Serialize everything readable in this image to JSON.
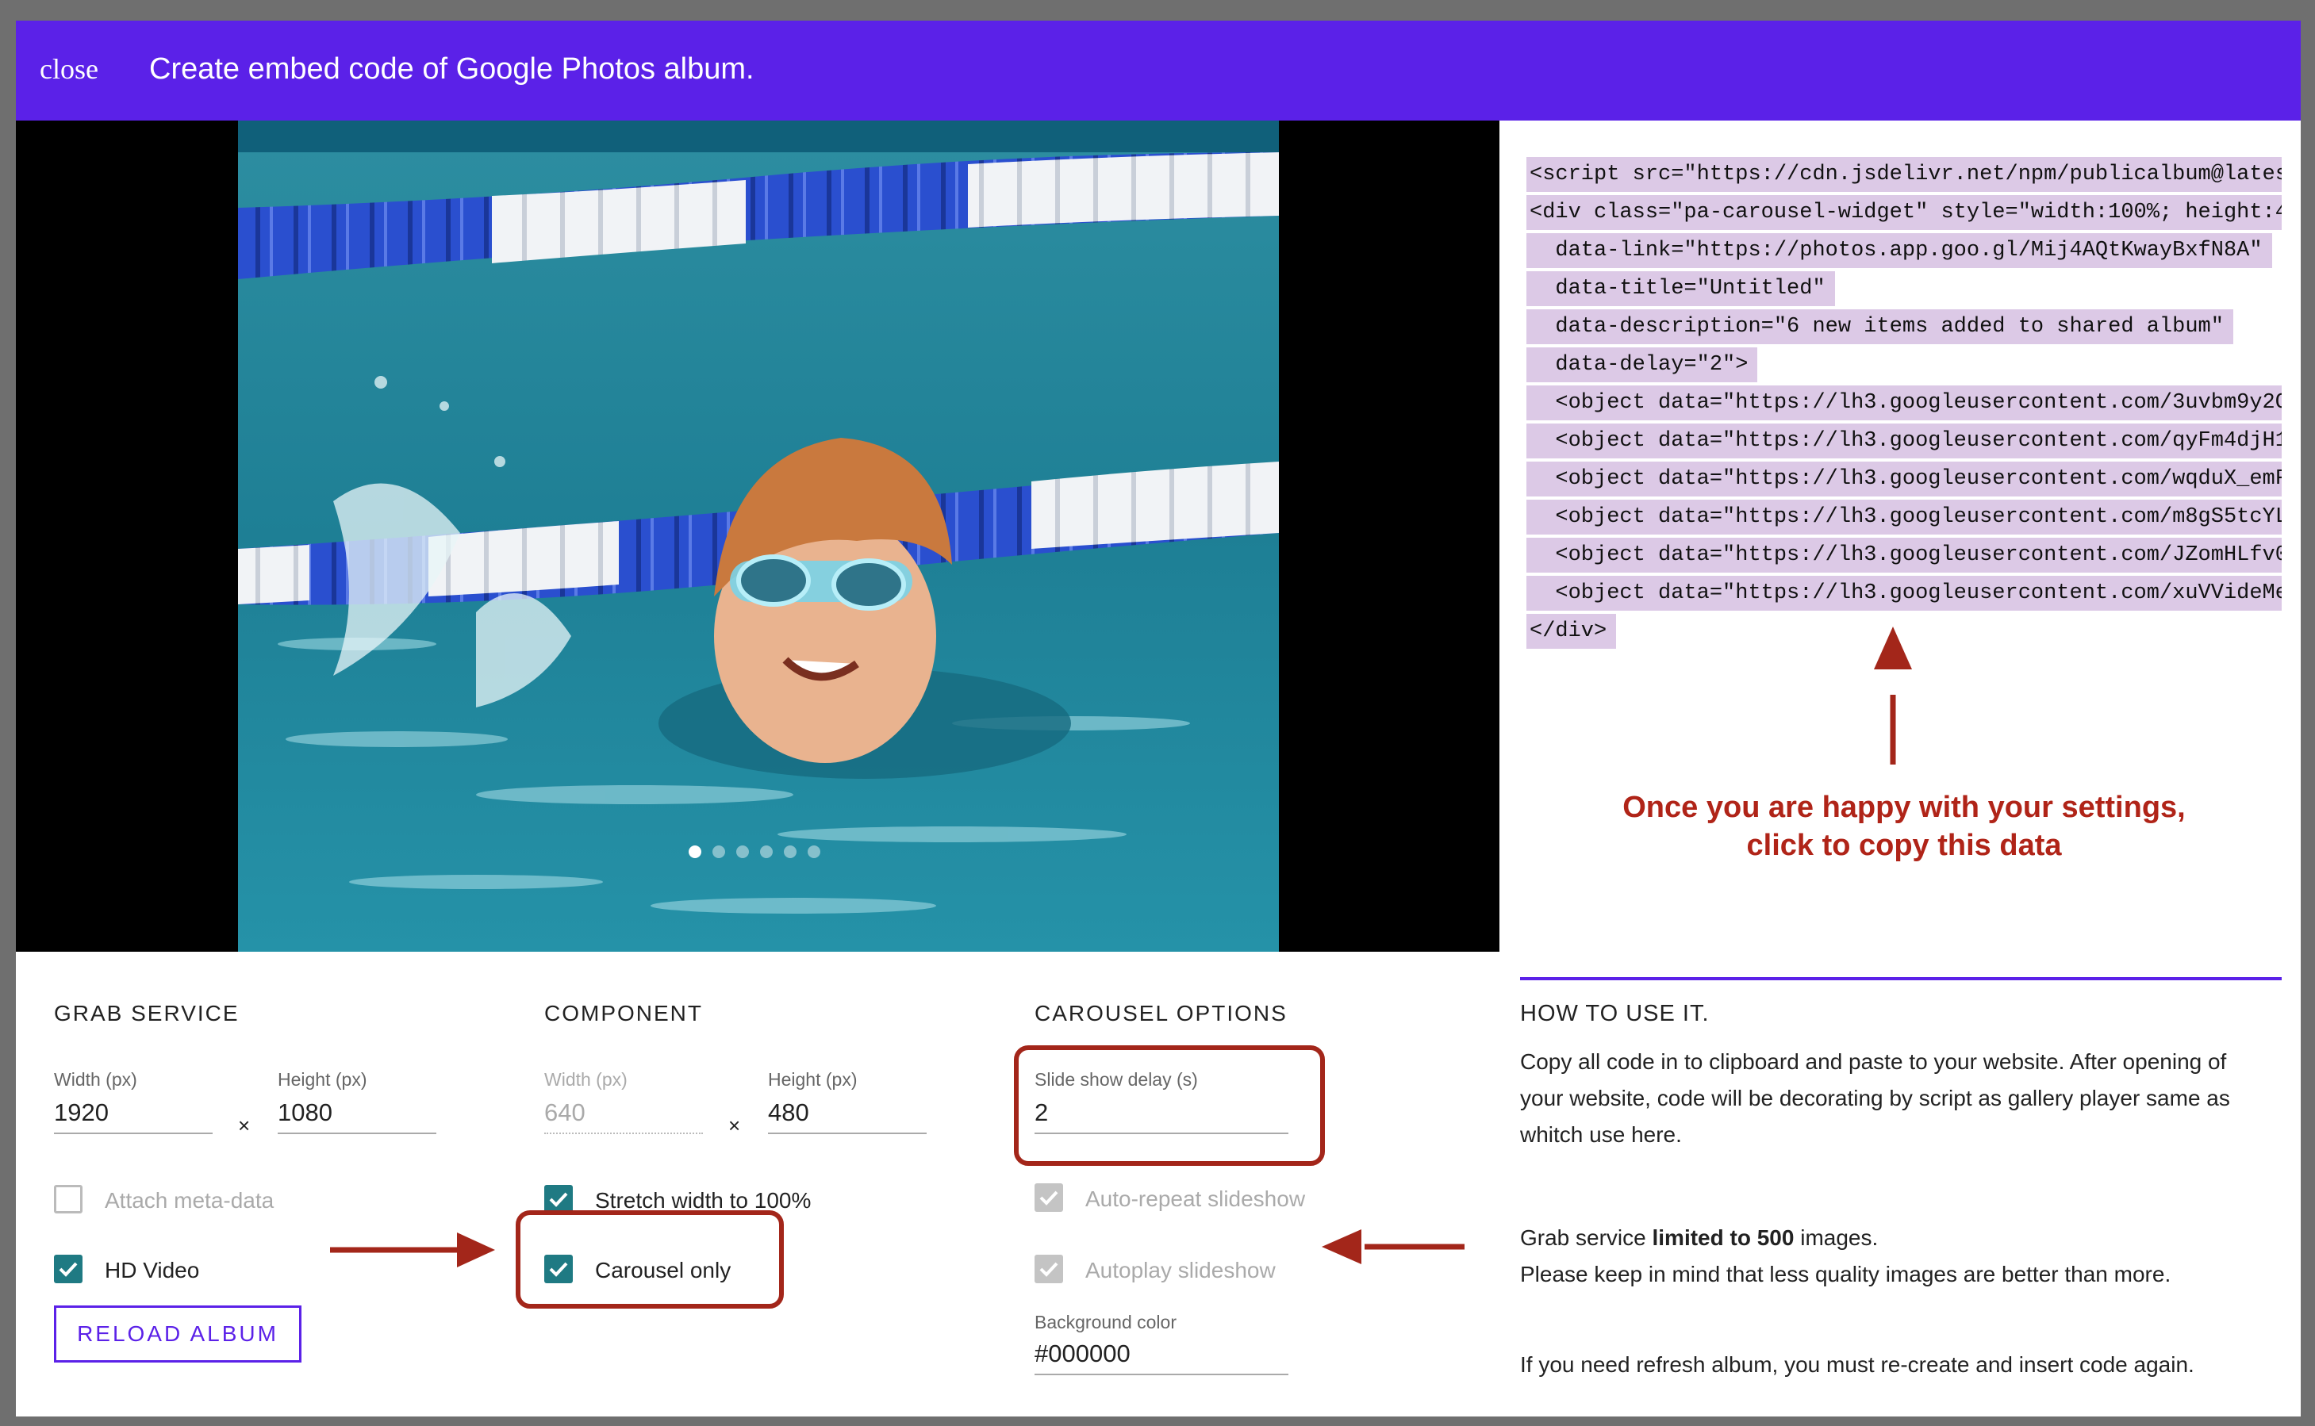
{
  "header": {
    "close_label": "close",
    "title": "Create embed code of Google Photos album."
  },
  "viewer": {
    "dots": [
      true,
      false,
      false,
      false,
      false,
      false
    ]
  },
  "code": {
    "lines": [
      "<script src=\"https://cdn.jsdelivr.net/npm/publicalbum@lates",
      "<div class=\"pa-carousel-widget\" style=\"width:100%; height:4",
      "  data-link=\"https://photos.app.goo.gl/Mij4AQtKwayBxfN8A\"",
      "  data-title=\"Untitled\"",
      "  data-description=\"6 new items added to shared album\"",
      "  data-delay=\"2\">",
      "  <object data=\"https://lh3.googleusercontent.com/3uvbm9y2O",
      "  <object data=\"https://lh3.googleusercontent.com/qyFm4djH1",
      "  <object data=\"https://lh3.googleusercontent.com/wqduX_emF",
      "  <object data=\"https://lh3.googleusercontent.com/m8gS5tcYL",
      "  <object data=\"https://lh3.googleusercontent.com/JZomHLfv0",
      "  <object data=\"https://lh3.googleusercontent.com/xuVVideMe",
      "</div>"
    ],
    "annotation_line1": "Once you are happy with your settings,",
    "annotation_line2": "click to copy this data"
  },
  "grab_service": {
    "title": "GRAB SERVICE",
    "width_label": "Width (px)",
    "width_value": "1920",
    "height_label": "Height (px)",
    "height_value": "1080",
    "times": "×",
    "attach_meta_label": "Attach meta-data",
    "hd_video_label": "HD Video",
    "reload_label": "RELOAD ALBUM"
  },
  "component": {
    "title": "COMPONENT",
    "width_label": "Width (px)",
    "width_value": "640",
    "height_label": "Height (px)",
    "height_value": "480",
    "times": "×",
    "stretch_label": "Stretch width to 100%",
    "carousel_only_label": "Carousel only"
  },
  "carousel_options": {
    "title": "CAROUSEL OPTIONS",
    "delay_label": "Slide show delay (s)",
    "delay_value": "2",
    "auto_repeat_label": "Auto-repeat slideshow",
    "autoplay_label": "Autoplay slideshow",
    "bg_color_label": "Background color",
    "bg_color_value": "#000000"
  },
  "how_to": {
    "title": "HOW TO USE IT.",
    "p1_line1": "Copy all code in to clipboard and paste to your website. After opening of",
    "p1_line2": "your website, code will be decorating by script as gallery player same as",
    "p1_line3": "whitch use here.",
    "p2_prefix": "Grab service ",
    "p2_bold": "limited to 500",
    "p2_suffix": " images.",
    "p2_line2": "Please keep in mind that less quality images are better than more.",
    "p3": "If you need refresh album, you must re-create and insert code again."
  },
  "colors": {
    "accent": "#5b21e8",
    "checkbox": "#1f7a83",
    "annotation": "#a3261a",
    "code_highlight": "#dcc9e6"
  }
}
